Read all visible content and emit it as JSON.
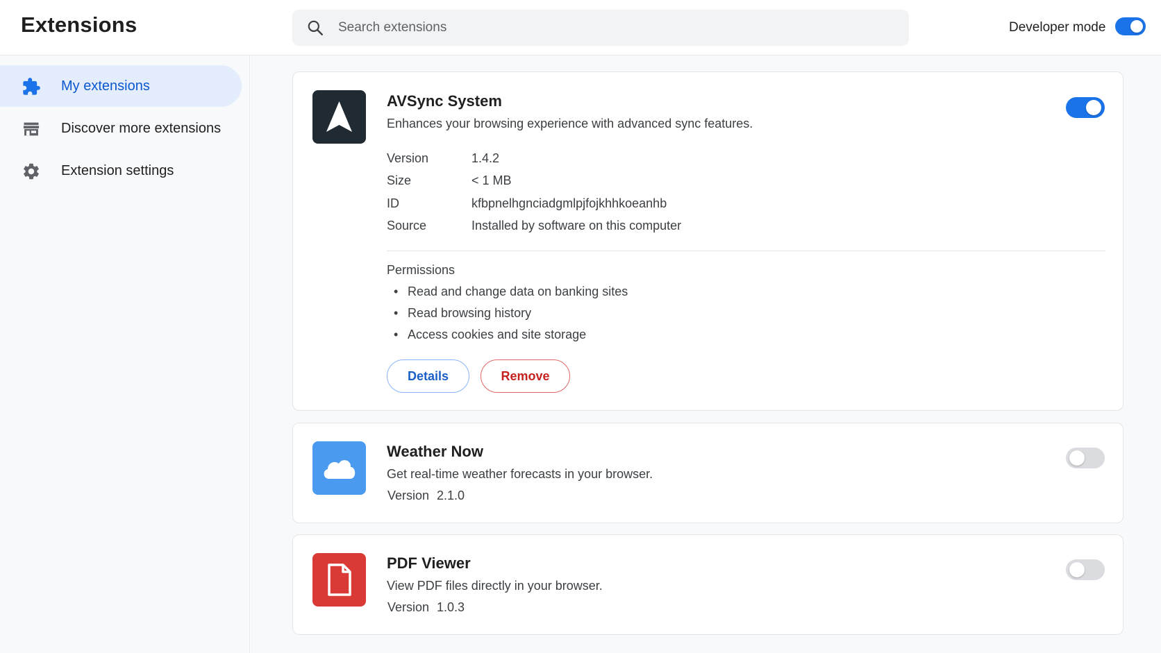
{
  "header": {
    "title": "Extensions",
    "search_placeholder": "Search extensions",
    "developer_mode_label": "Developer mode",
    "developer_mode_on": true
  },
  "sidebar": {
    "items": [
      {
        "label": "My extensions",
        "icon": "puzzle-icon",
        "active": true
      },
      {
        "label": "Discover more extensions",
        "icon": "store-icon",
        "active": false
      },
      {
        "label": "Extension settings",
        "icon": "gear-icon",
        "active": false
      }
    ]
  },
  "extensions": [
    {
      "name": "AVSync System",
      "description": "Enhances your browsing experience with advanced sync features.",
      "icon": "navigation-arrow-icon",
      "icon_bg": "#1f2a33",
      "enabled": true,
      "details": [
        {
          "label": "Version",
          "value": "1.4.2"
        },
        {
          "label": "Size",
          "value": "< 1 MB"
        },
        {
          "label": "ID",
          "value": "kfbpnelhgnciadgmlpjfojkhhkoeanhb"
        },
        {
          "label": "Source",
          "value": "Installed by software on this computer"
        }
      ],
      "permissions_title": "Permissions",
      "permissions": [
        "Read and change data on banking sites",
        "Read browsing history",
        "Access cookies and site storage"
      ],
      "details_button": "Details",
      "remove_button": "Remove"
    },
    {
      "name": "Weather Now",
      "description": "Get real-time weather forecasts in your browser.",
      "icon": "cloud-icon",
      "icon_bg": "#4a9af0",
      "enabled": false,
      "version_label": "Version",
      "version": "2.1.0"
    },
    {
      "name": "PDF Viewer",
      "description": "View PDF files directly in your browser.",
      "icon": "document-icon",
      "icon_bg": "#d93a35",
      "enabled": false,
      "version_label": "Version",
      "version": "1.0.3"
    }
  ],
  "colors": {
    "accent": "#1a73e8",
    "active_nav_bg": "#e3edfb",
    "remove_red": "#c5221f"
  }
}
